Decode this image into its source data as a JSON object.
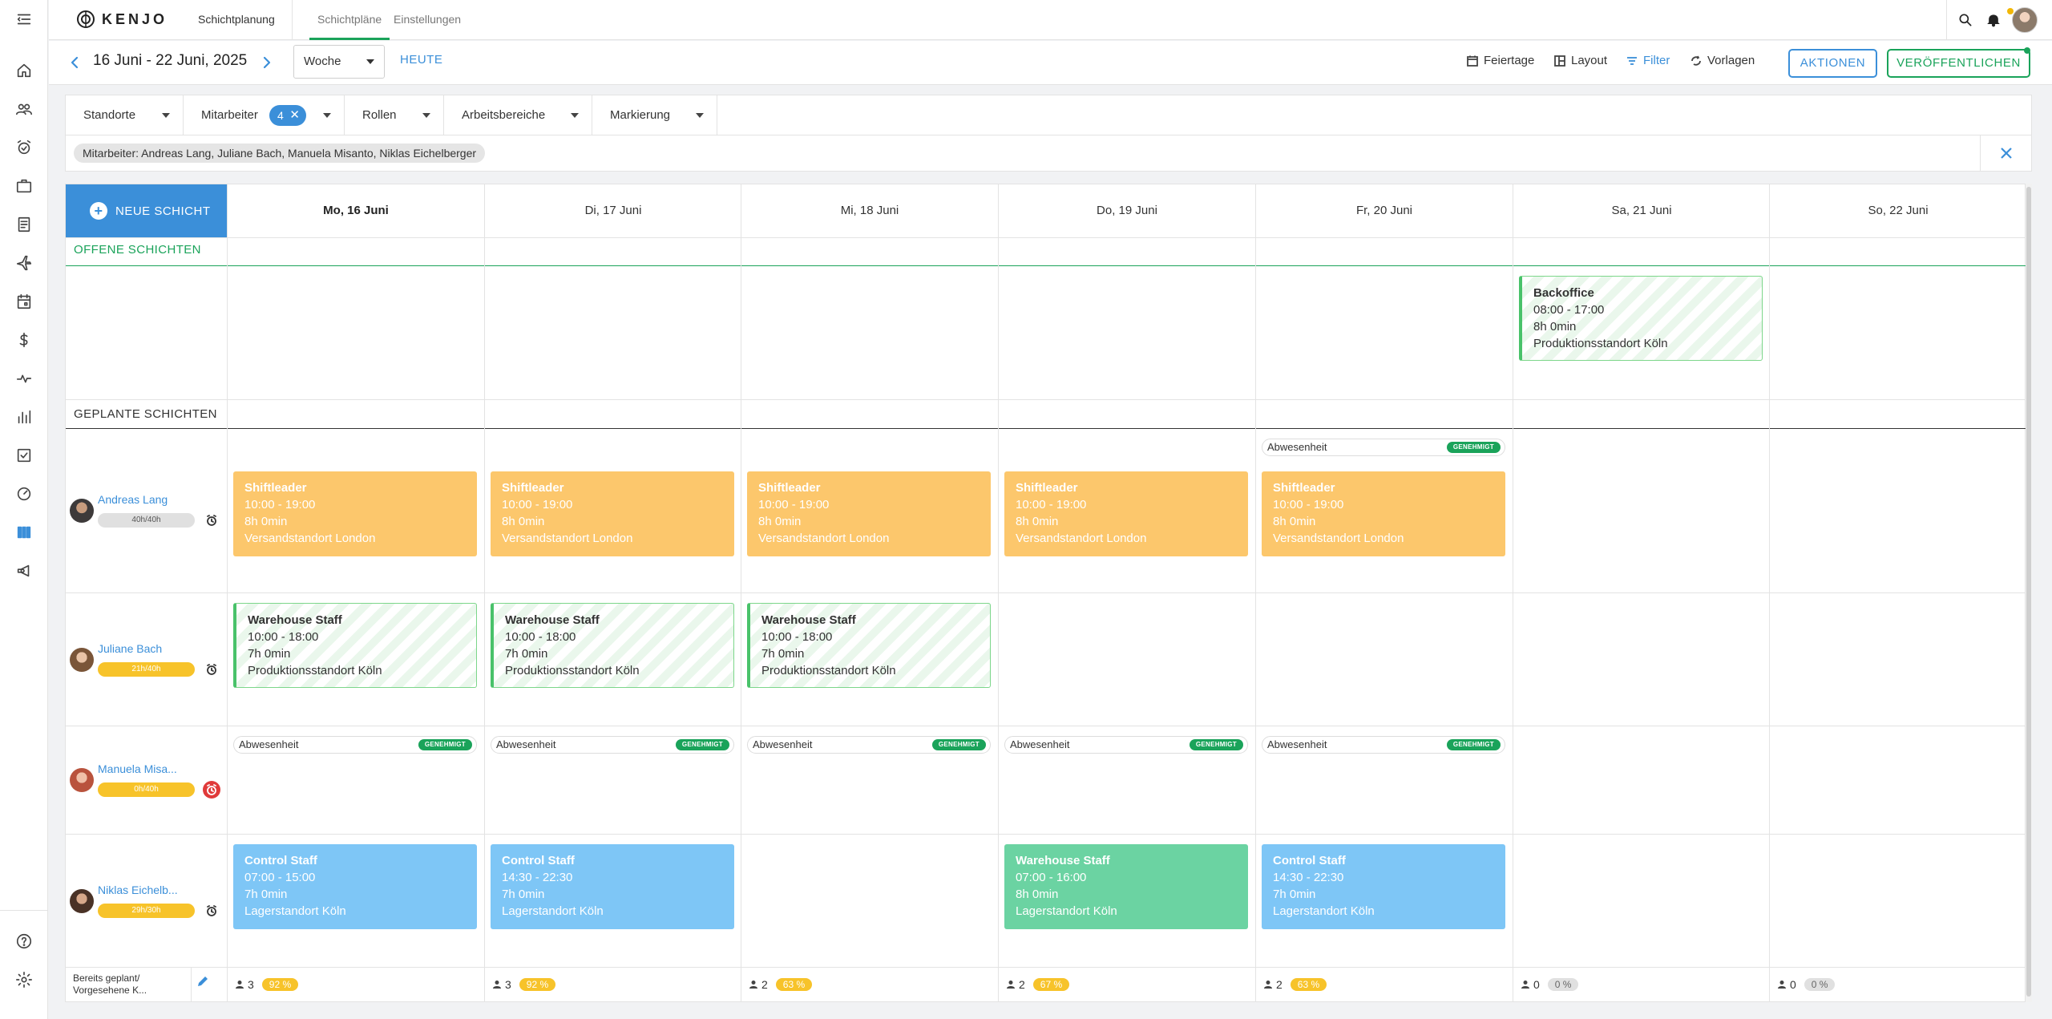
{
  "app": {
    "logo_text": "KENJO",
    "module_title": "Schichtplanung",
    "tabs": [
      "Schichtpläne",
      "Einstellungen"
    ],
    "active_tab": "Schichtpläne"
  },
  "rail": {
    "items": [
      "menu-icon",
      "home-icon",
      "people-icon",
      "alarm-icon",
      "briefcase-icon",
      "document-icon",
      "plane-icon",
      "calendar-icon",
      "dollar-icon",
      "pulse-icon",
      "bar-chart-icon",
      "checklist-icon",
      "gauge-icon",
      "shift-planning-icon",
      "megaphone-icon",
      "help-icon",
      "settings-icon"
    ],
    "active": "shift-planning-icon"
  },
  "toolbar": {
    "date_range": "16 Juni - 22 Juni, 2025",
    "view": "Woche",
    "today": "HEUTE",
    "feiertage": "Feiertage",
    "layout": "Layout",
    "filter": "Filter",
    "vorlagen": "Vorlagen",
    "aktionen": "AKTIONEN",
    "publish": "VERÖFFENTLICHEN"
  },
  "filters": {
    "standorte": "Standorte",
    "mitarbeiter": "Mitarbeiter",
    "mitarbeiter_count": "4",
    "rollen": "Rollen",
    "arbeitsbereiche": "Arbeitsbereiche",
    "markierung": "Markierung",
    "chip": "Mitarbeiter: Andreas Lang, Juliane Bach, Manuela Misanto, Niklas Eichelberger"
  },
  "grid": {
    "new_shift": "NEUE SCHICHT",
    "days": [
      "Mo, 16 Juni",
      "Di, 17 Juni",
      "Mi, 18 Juni",
      "Do, 19 Juni",
      "Fr, 20 Juni",
      "Sa, 21 Juni",
      "So, 22 Juni"
    ],
    "today_index": 0,
    "open_title": "OFFENE SCHICHTEN",
    "planned_title": "GEPLANTE SCHICHTEN",
    "open_shifts": [
      {
        "role": "Backoffice",
        "time": "08:00 - 17:00",
        "duration": "8h 0min",
        "location": "Produktionsstandort Köln"
      }
    ],
    "absence_label": "Abwesenheit",
    "absence_badge": "GENEHMIGT",
    "employees": [
      {
        "name": "Andreas Lang",
        "hours": "40h/40h",
        "shifts": [
          {
            "role": "Shiftleader",
            "time": "10:00 - 19:00",
            "duration": "8h 0min",
            "location": "Versandstandort London"
          },
          {
            "role": "Shiftleader",
            "time": "10:00 - 19:00",
            "duration": "8h 0min",
            "location": "Versandstandort London"
          },
          {
            "role": "Shiftleader",
            "time": "10:00 - 19:00",
            "duration": "8h 0min",
            "location": "Versandstandort London"
          },
          {
            "role": "Shiftleader",
            "time": "10:00 - 19:00",
            "duration": "8h 0min",
            "location": "Versandstandort London"
          },
          {
            "role": "Shiftleader",
            "time": "10:00 - 19:00",
            "duration": "8h 0min",
            "location": "Versandstandort London"
          }
        ]
      },
      {
        "name": "Juliane Bach",
        "hours": "21h/40h",
        "shifts": [
          {
            "role": "Warehouse Staff",
            "time": "10:00 - 18:00",
            "duration": "7h 0min",
            "location": "Produktionsstandort Köln"
          },
          {
            "role": "Warehouse Staff",
            "time": "10:00 - 18:00",
            "duration": "7h 0min",
            "location": "Produktionsstandort Köln"
          },
          {
            "role": "Warehouse Staff",
            "time": "10:00 - 18:00",
            "duration": "7h 0min",
            "location": "Produktionsstandort Köln"
          }
        ]
      },
      {
        "name": "Manuela Misa...",
        "hours": "0h/40h",
        "shifts": []
      },
      {
        "name": "Niklas Eichelb...",
        "hours": "29h/30h",
        "shifts": [
          {
            "role": "Control Staff",
            "time": "07:00 - 15:00",
            "duration": "7h 0min",
            "location": "Lagerstandort Köln"
          },
          {
            "role": "Control Staff",
            "time": "14:30 - 22:30",
            "duration": "7h 0min",
            "location": "Lagerstandort Köln"
          },
          {
            "role": "Warehouse Staff",
            "time": "07:00 - 16:00",
            "duration": "8h 0min",
            "location": "Lagerstandort Köln"
          },
          {
            "role": "Control Staff",
            "time": "14:30 - 22:30",
            "duration": "7h 0min",
            "location": "Lagerstandort Köln"
          }
        ]
      }
    ],
    "footer_label_1": "Bereits geplant/",
    "footer_label_2": "Vorgesehene K...",
    "footer": [
      {
        "count": "3",
        "pct": "92 %"
      },
      {
        "count": "3",
        "pct": "92 %"
      },
      {
        "count": "2",
        "pct": "63 %"
      },
      {
        "count": "2",
        "pct": "67 %"
      },
      {
        "count": "2",
        "pct": "63 %"
      },
      {
        "count": "0",
        "pct": "0 %"
      },
      {
        "count": "0",
        "pct": "0 %"
      }
    ]
  },
  "colors": {
    "accent_blue": "#3b8fd9",
    "green": "#1aa35a",
    "shift_orange": "#fcc76c",
    "shift_blue": "#7ec6f6",
    "shift_green": "#6bd3a2"
  }
}
